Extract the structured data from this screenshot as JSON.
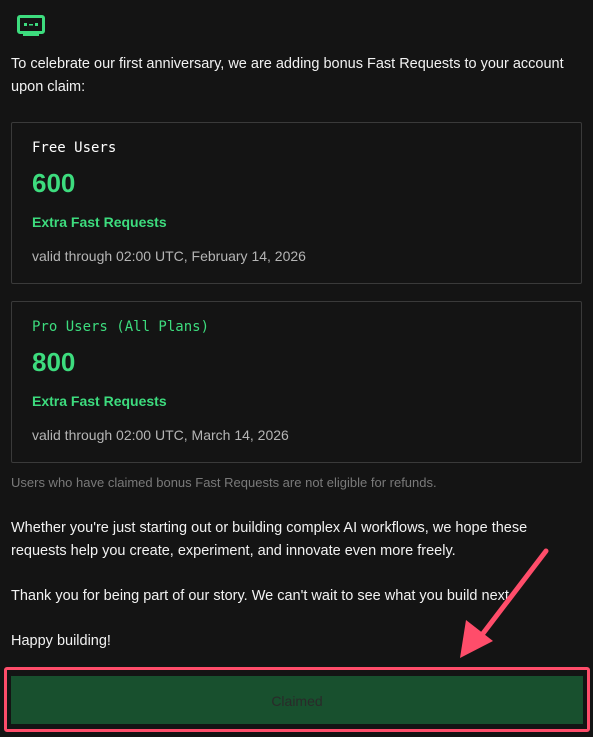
{
  "logo": {
    "icon": "robot-face-icon",
    "color": "#3ddc7e"
  },
  "intro_text": "To celebrate our first anniversary, we are adding bonus Fast Requests to your account upon claim:",
  "cards": [
    {
      "title": "Free Users",
      "amount": "600",
      "label": "Extra Fast Requests",
      "valid": "valid through 02:00 UTC, February 14, 2026"
    },
    {
      "title": "Pro Users (All Plans)",
      "amount": "800",
      "label": "Extra Fast Requests",
      "valid": "valid through 02:00 UTC, March 14, 2026"
    }
  ],
  "refund_note": "Users who have claimed bonus Fast Requests are not eligible for refunds.",
  "paragraphs": [
    "Whether you're just starting out or building complex AI workflows, we hope these requests help you create, experiment, and innovate even more freely.",
    "Thank you for being part of our story. We can't wait to see what you build next.",
    "Happy building!"
  ],
  "claim_button": {
    "label": "Claimed",
    "background": "#18502e"
  },
  "colors": {
    "accent": "#3ddc7e",
    "background": "#141414",
    "annotation": "#ff4d6a"
  }
}
